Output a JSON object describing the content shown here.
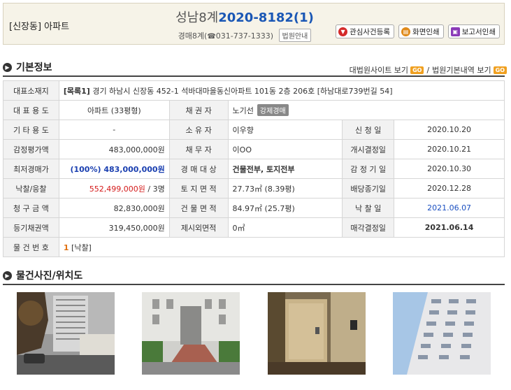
{
  "header": {
    "category": "[신장동] 아파트",
    "court": "성남8계",
    "case_no": "2020-8182(1)",
    "dept": "경매8계",
    "phone": "031-737-1333",
    "court_guide": "법원안내",
    "buttons": [
      "관심사건등록",
      "화면인쇄",
      "보고서인쇄"
    ]
  },
  "section_basic": {
    "title": "기본정보",
    "link1": "대법원사이트 보기",
    "link2": "법원기본내역 보기",
    "sep": "/",
    "go": "GO"
  },
  "info": {
    "address_label": "대표소재지",
    "address_prefix": "[목록1]",
    "address": " 경기 하남시 신장동 452-1 석바대마을동신아파트 101동 2층 206호 [하남대로739번길 54]",
    "rows": [
      {
        "l1": "대 표 용 도",
        "v1": "아파트 (33평형)",
        "l2": "채 권 자",
        "v2": "노기선",
        "tag": "강제경매"
      },
      {
        "l1": "기 타 용 도",
        "v1": "-",
        "l2": "소 유 자",
        "v2": "이우향",
        "l3": "신 청 일",
        "v3": "2020.10.20"
      },
      {
        "l1": "감정평가액",
        "v1": "483,000,000원",
        "l2": "채 무 자",
        "v2": "이OO",
        "l3": "개시결정일",
        "v3": "2020.10.21"
      },
      {
        "l1": "최저경매가",
        "v1": "(100%) 483,000,000원",
        "l2": "경 매 대 상",
        "v2": "건물전부, 토지전부",
        "l3": "감 정 기 일",
        "v3": "2020.10.30"
      },
      {
        "l1": "낙찰/응찰",
        "v1": "552,499,000원",
        "v1b": " / 3명",
        "l2": "토 지 면 적",
        "v2": "27.73㎡ (8.39평)",
        "l3": "배당종기일",
        "v3": "2020.12.28"
      },
      {
        "l1": "청 구 금 액",
        "v1": "82,830,000원",
        "l2": "건 물 면 적",
        "v2": "84.97㎡ (25.7평)",
        "l3": "낙 찰 일",
        "v3": "2021.06.07"
      },
      {
        "l1": "등기채권액",
        "v1": "319,450,000원",
        "l2": "제시외면적",
        "v2": "0㎡",
        "l3": "매각결정일",
        "v3": "2021.06.14"
      }
    ],
    "item_label": "물 건 번 호",
    "item_no": "1",
    "item_status": " [낙찰]"
  },
  "section_photo": {
    "title": "물건사진/위치도"
  },
  "colors": {
    "case_blue": "#1a57b5",
    "accent_orange": "#f0a020",
    "header_bg": "#f6f3e8"
  }
}
